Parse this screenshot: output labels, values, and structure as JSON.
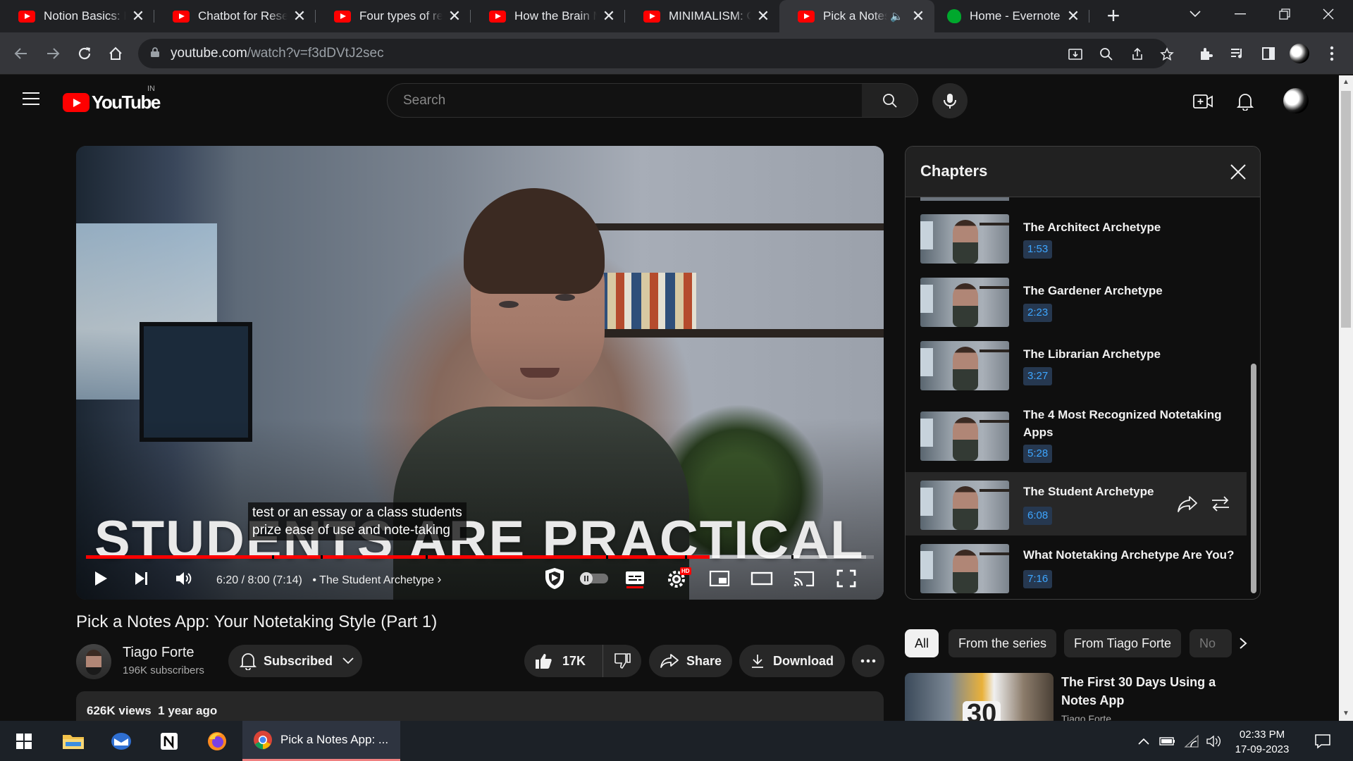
{
  "browser": {
    "tabs": [
      {
        "title": "Notion Basics: How to",
        "icon": "youtube-icon"
      },
      {
        "title": "Chatbot for Research",
        "icon": "youtube-icon"
      },
      {
        "title": "Four types of research",
        "icon": "youtube-icon"
      },
      {
        "title": "How the Brain Makes",
        "icon": "youtube-icon"
      },
      {
        "title": "MINIMALISM: Official",
        "icon": "youtube-icon"
      },
      {
        "title": "Pick a Notes App",
        "icon": "youtube-icon",
        "active": true,
        "audio": true
      },
      {
        "title": "Home - Evernote",
        "icon": "evernote-icon"
      }
    ],
    "url_host": "youtube.com",
    "url_path": "/watch?v=f3dDVtJ2sec"
  },
  "youtube": {
    "logo_text": "YouTube",
    "country_code": "IN",
    "search_placeholder": "Search"
  },
  "player": {
    "caption_line1": "test or an essay or a class students",
    "caption_line2": "prize ease of use and note-taking",
    "overlay_title": "STUDENTS ARE PRACTICAL",
    "time_current": "6:20",
    "time_total": "8:00",
    "time_adjusted": "(7:14)",
    "chapter_separator": "•",
    "current_chapter": "The Student Archetype",
    "progress_fraction": 0.792,
    "buffer_fraction": 0.99,
    "chapter_marks": [
      0.236,
      0.298,
      0.431,
      0.66,
      0.76,
      0.895
    ],
    "hd_badge": "HD",
    "accent": "#ff0000"
  },
  "chapters": {
    "heading": "Chapters",
    "items": [
      {
        "title": "The Architect Archetype",
        "time": "1:53"
      },
      {
        "title": "The Gardener Archetype",
        "time": "2:23"
      },
      {
        "title": "The Librarian Archetype",
        "time": "3:27"
      },
      {
        "title": "The 4 Most Recognized Notetaking Apps",
        "time": "5:28"
      },
      {
        "title": "The Student Archetype",
        "time": "6:08",
        "active": true
      },
      {
        "title": "What Notetaking Archetype Are You?",
        "time": "7:16"
      }
    ]
  },
  "video": {
    "title": "Pick a Notes App: Your Notetaking Style (Part 1)",
    "channel": "Tiago Forte",
    "subscribers": "196K subscribers",
    "subscribe_label": "Subscribed",
    "likes": "17K",
    "share_label": "Share",
    "download_label": "Download",
    "views": "626K views",
    "age": "1 year ago"
  },
  "rail": {
    "chips": [
      "All",
      "From the series",
      "From Tiago Forte",
      "No"
    ],
    "reco": {
      "title": "The First 30 Days Using a Notes App",
      "channel": "Tiago Forte",
      "thumb_text": "30"
    }
  },
  "taskbar": {
    "active_app_label": "Pick a Notes App: ...",
    "time": "02:33 PM",
    "date": "17-09-2023"
  }
}
